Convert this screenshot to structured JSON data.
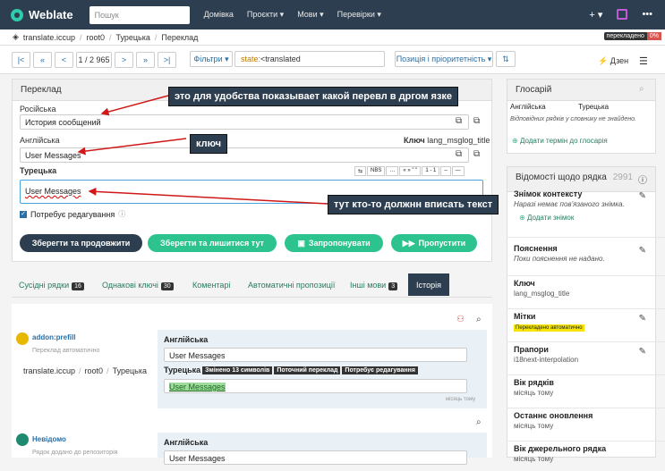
{
  "app": {
    "name": "Weblate",
    "search_placeholder": "Пошук"
  },
  "nav": [
    "Домівка",
    "Проєкти ▾",
    "Мови ▾",
    "Перевірки ▾"
  ],
  "top_right": {
    "plus": "+ ▾",
    "more": "•••"
  },
  "breadcrumb": {
    "project": "translate.iccup",
    "component": "root0",
    "language": "Турецька",
    "page": "Переклад"
  },
  "status_badge": {
    "label": "перекладено",
    "pct": "0%"
  },
  "toolbar": {
    "first": "|<",
    "prev2": "«",
    "prev": "<",
    "position": "1 / 2 965",
    "next": ">",
    "next2": "»",
    "last": ">|",
    "filters": "Фільтри ▾",
    "query_key": "state:",
    "query_val": "<translated",
    "sort": "Позиція і пріоритетність ▾",
    "zen": "Дзен"
  },
  "translate": {
    "title": "Переклад",
    "ru_label": "Російська",
    "ru_value": "История сообщений",
    "en_label": "Англійська",
    "key_label": "Ключ",
    "key_value": "lang_msglog_title",
    "en_value": "User Messages",
    "tr_label": "Турецька",
    "tr_value": "User Messages",
    "needs_edit": "Потребує редагування",
    "nbs": "NBS",
    "ell": "…",
    "quote": "« » \" \"",
    "one": "1 - 1"
  },
  "actions": {
    "save_continue": "Зберегти та продовжити",
    "save_stay": "Зберегти та лишитися тут",
    "suggest": "Запропонувати",
    "skip": "Пропустити"
  },
  "tabs": [
    {
      "label": "Сусідні рядки",
      "count": "16"
    },
    {
      "label": "Однакові ключі",
      "count": "30"
    },
    {
      "label": "Коментарі",
      "count": ""
    },
    {
      "label": "Автоматичні пропозиції",
      "count": ""
    },
    {
      "label": "Інші мови",
      "count": "3"
    },
    {
      "label": "Історія",
      "count": ""
    }
  ],
  "history": [
    {
      "user": "addon:prefill",
      "note": "Переклад автоматично",
      "project": "translate.iccup",
      "component": "root0",
      "language": "Турецька",
      "en_label": "Англійська",
      "en_value": "User Messages",
      "tr_label": "Турецька",
      "tags": [
        "Змінено 13 символів",
        "Поточний переклад",
        "Потребує редагування"
      ],
      "tr_value": "User Messages",
      "time": "місяць тому"
    },
    {
      "user": "Невідомо",
      "note": "Рядок додано до репозиторія",
      "en_label": "Англійська",
      "en_value": "User Messages"
    }
  ],
  "glossary": {
    "title": "Глосарій",
    "col1": "Англійська",
    "col2": "Турецька",
    "empty": "Відповідних рядків у словнику не знайдено.",
    "add": "Додати термін до глосарія"
  },
  "info": {
    "title": "Відомості щодо рядка",
    "count": "2991",
    "rows": [
      {
        "t": "Знімок контексту",
        "v": "Наразі немає пов'язаного знімка.",
        "i": true,
        "link": "Додати знімок"
      },
      {
        "t": "Пояснення",
        "v": "Поки пояснення не надано.",
        "i": true
      },
      {
        "t": "Ключ",
        "v": "lang_msglog_title"
      },
      {
        "t": "Мітки",
        "v": "Перекладено автоматично",
        "hl": true
      },
      {
        "t": "Прапори",
        "v": "i18next-interpolation"
      },
      {
        "t": "Вік рядків",
        "v": "місяць тому"
      },
      {
        "t": "Останнє оновлення",
        "v": "місяць тому"
      },
      {
        "t": "Вік джерельного рядка",
        "v": "місяць тому"
      }
    ]
  },
  "annotations": {
    "a1": "это для удобства показывает какой перевл в дргом язке",
    "a2": "ключ",
    "a3": "тут кто-то должнн вписать текст"
  },
  "colors": {
    "header": "#2d3e50",
    "accent": "#2eccaa",
    "dark_btn": "#2d3e50",
    "green_btn": "#2cc38f",
    "arrow": "#d01818"
  }
}
